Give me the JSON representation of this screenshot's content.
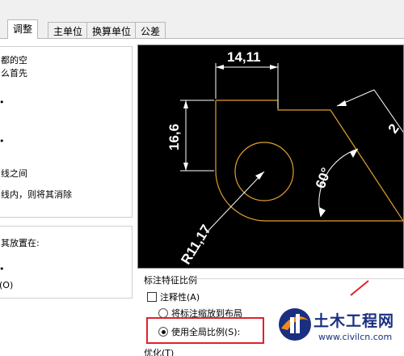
{
  "tabs": [
    {
      "label": "调整",
      "active": true
    },
    {
      "label": "主单位",
      "active": false
    },
    {
      "label": "换算单位",
      "active": false
    },
    {
      "label": "公差",
      "active": false
    }
  ],
  "left_group1": {
    "lines": [
      "都的空",
      "么首先",
      "线之间",
      "线内，则将其消除"
    ],
    "bullets": [
      "•",
      "•"
    ]
  },
  "left_group2": {
    "text1": "其放置在:",
    "bullet": "•",
    "text2": "(O)"
  },
  "preview": {
    "dim_top": "14,11",
    "dim_left": "16,6",
    "dim_radius": "R11,17",
    "dim_angle": "60°",
    "dim_right_partial": "2",
    "colors": {
      "background": "#000000",
      "geometry": "#e0a030",
      "dimension": "#ffffff"
    }
  },
  "scale": {
    "title": "标注特征比例",
    "annotative_label": "注释性(A)",
    "annotative_checked": false,
    "layout_label": "将标注缩放到布局",
    "global_label": "使用全局比例(S):",
    "selected": "global"
  },
  "bottom": {
    "label": "优化(T)"
  },
  "watermark": {
    "title": "土木工程网",
    "url": "www.civilcn.com",
    "colors": {
      "blue": "#1a2f80",
      "orange": "#f28a1a"
    }
  },
  "highlight_color": "#e0222a"
}
